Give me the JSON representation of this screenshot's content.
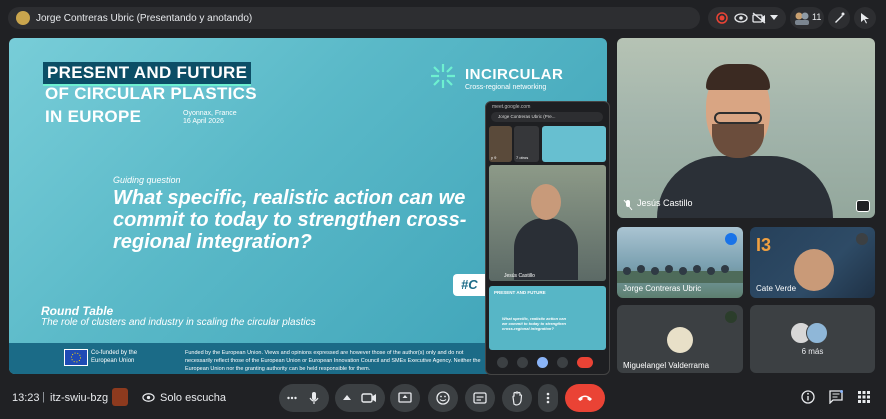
{
  "topbar": {
    "presenter_label": "Jorge Contreras Ubric (Presentando y anotando)",
    "participant_count": "11"
  },
  "slide": {
    "title_lines": [
      "PRESENT AND FUTURE",
      "OF CIRCULAR PLASTICS",
      "IN EUROPE"
    ],
    "place": "Oyonnax, France",
    "date": "16 April 2026",
    "brand_name": "INCIRCULAR",
    "brand_sub": "Cross-regional networking",
    "guiding_label": "Guiding question",
    "question": "What specific, realistic action can we commit to today to strengthen cross-regional integration?",
    "hashtag": "#C",
    "roundtable_title": "Round Table",
    "roundtable_sub": "The role of clusters and industry in scaling the circular plastics",
    "eu_text": "Co-funded by the European Union",
    "disclaimer": "Funded by the European Union. Views and opinions expressed are however those of the author(s) only and do not necessarily reflect those of the European Union or European Innovation Council and SMEs Executive Agency. Neither the European Union nor the granting authority can be held responsible for them."
  },
  "phone": {
    "url": "meet.google.com",
    "bar_text": "Jorge Contreras Ubric (Pre...",
    "thumb1_label": "y 9",
    "thumb2_label": "7 otros",
    "main_name": "Jesús Castillo"
  },
  "tiles": {
    "jesus": {
      "name": "Jesús Castillo"
    },
    "jorge": {
      "name": "Jorge Contreras Ubric"
    },
    "cate": {
      "name": "Cate Verde",
      "logo": "I3"
    },
    "miguel": {
      "name": "Miguelangel Valderrama"
    },
    "more": {
      "label": "6 más"
    }
  },
  "bottom": {
    "time": "13:23",
    "divider": "|",
    "meeting_code": "itz-swiu-bzg",
    "listen_label": "Solo escucha"
  },
  "colors": {
    "background": "#202124",
    "hangup": "#ea4335",
    "slide_accent": "#1b6b87"
  },
  "icons": [
    "record-icon",
    "eye-icon",
    "camera-off-icon",
    "chevron-down-icon",
    "people-icon",
    "pen-icon",
    "pointer-icon",
    "mic-icon",
    "camera-icon",
    "present-icon",
    "emoji-icon",
    "captions-icon",
    "hand-icon",
    "more-icon",
    "hangup-icon",
    "info-icon",
    "chat-icon",
    "apps-icon"
  ]
}
